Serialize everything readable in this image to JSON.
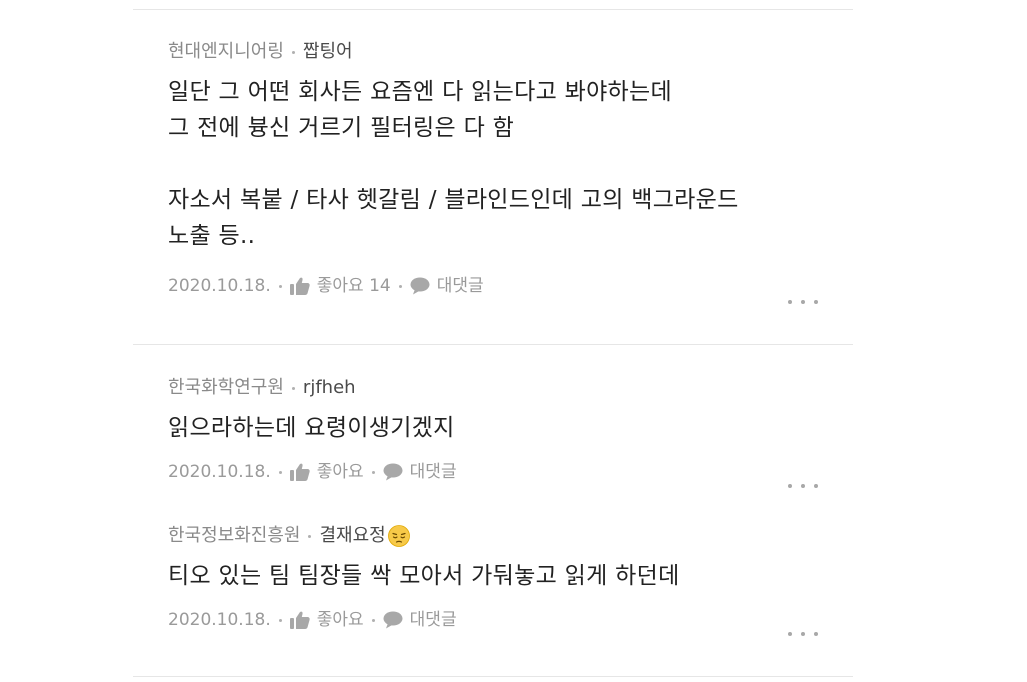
{
  "comments": [
    {
      "company": "현대엔지니어링",
      "nickname": "짭팅어",
      "body": "일단 그 어떤 회사든 요즘엔 다 읽는다고 봐야하는데\n그 전에 븅신 거르기 필터링은 다 함\n\n자소서 복붙 / 타사 헷갈림  / 블라인드인데 고의 백그라운드\n노출 등..",
      "date": "2020.10.18.",
      "like_label": "좋아요 14",
      "reply_label": "대댓글"
    },
    {
      "company": "한국화학연구원",
      "nickname": "rjfheh",
      "body": "읽으라하는데 요령이생기겠지",
      "date": "2020.10.18.",
      "like_label": "좋아요",
      "reply_label": "대댓글"
    },
    {
      "company": "한국정보화진흥원",
      "nickname": "결재요정",
      "nickname_emoji": "pensive-face-emoji",
      "body": "티오 있는 팀 팀장들 싹 모아서 가둬놓고 읽게 하던데",
      "date": "2020.10.18.",
      "like_label": "좋아요",
      "reply_label": "대댓글"
    }
  ],
  "icons": {
    "like": "thumbs-up-icon",
    "reply": "speech-bubble-icon",
    "more": "more-dots-icon"
  },
  "colors": {
    "meta_text": "#8a8a8a",
    "nickname_text": "#4a4a4a",
    "body_text": "#222222",
    "divider": "#e6e6e6",
    "icon_gray": "#a8a8a8"
  }
}
